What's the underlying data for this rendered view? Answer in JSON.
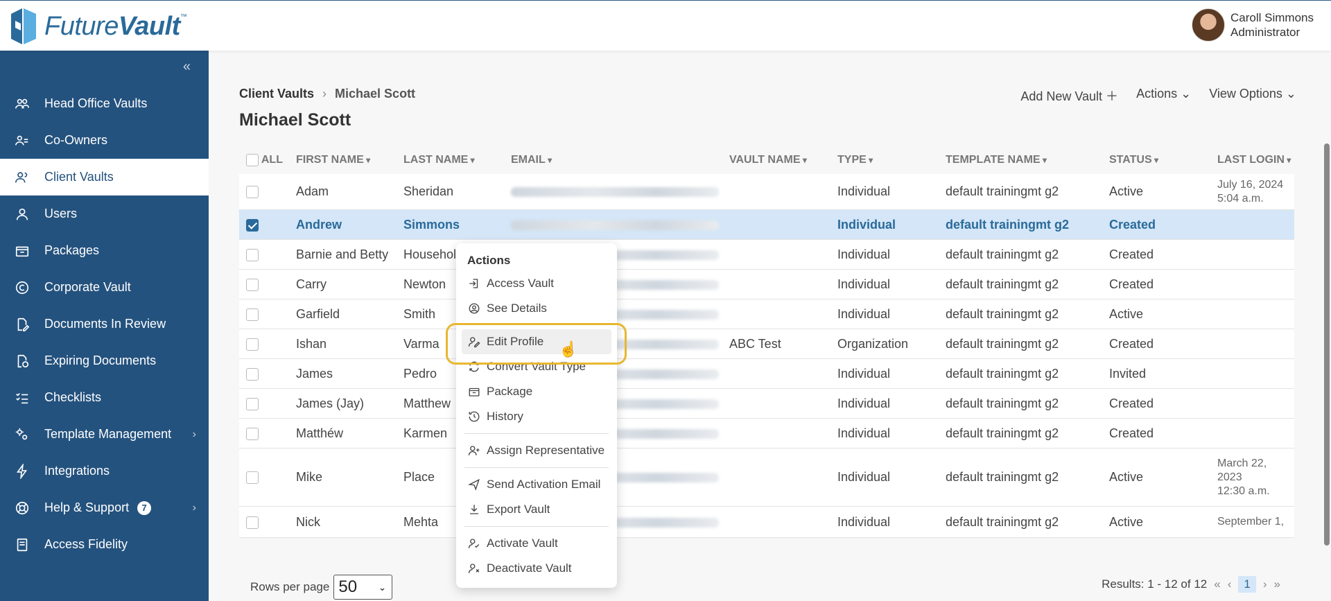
{
  "app": {
    "logo_prefix": "Future",
    "logo_bold": "Vault",
    "logo_tm": "™"
  },
  "user": {
    "name": "Caroll Simmons",
    "role": "Administrator"
  },
  "sidebar": {
    "collapse": "«",
    "items": [
      {
        "label": "Head Office Vaults",
        "icon": "users-group-icon"
      },
      {
        "label": "Co-Owners",
        "icon": "co-owners-icon"
      },
      {
        "label": "Client Vaults",
        "icon": "client-icon",
        "active": true
      },
      {
        "label": "Users",
        "icon": "user-icon"
      },
      {
        "label": "Packages",
        "icon": "package-icon"
      },
      {
        "label": "Corporate Vault",
        "icon": "copyright-icon"
      },
      {
        "label": "Documents In Review",
        "icon": "document-edit-icon"
      },
      {
        "label": "Expiring Documents",
        "icon": "document-clock-icon"
      },
      {
        "label": "Checklists",
        "icon": "checklist-icon"
      },
      {
        "label": "Template Management",
        "icon": "template-gear-icon",
        "chevron": "›"
      },
      {
        "label": "Integrations",
        "icon": "bolt-icon"
      },
      {
        "label": "Help & Support",
        "icon": "lifebuoy-icon",
        "badge": "7",
        "chevron": "›"
      },
      {
        "label": "Access Fidelity",
        "icon": "book-icon"
      }
    ]
  },
  "breadcrumb": {
    "parent": "Client Vaults",
    "sep": "›",
    "current": "Michael Scott"
  },
  "page_title": "Michael Scott",
  "top_actions": {
    "add": "Add New Vault ＋",
    "actions": "Actions ⌄",
    "view": "View Options ⌄"
  },
  "table": {
    "headers": {
      "all": "ALL",
      "first": "FIRST NAME",
      "last": "LAST NAME",
      "email": "EMAIL",
      "vault": "VAULT NAME",
      "type": "TYPE",
      "template": "TEMPLATE NAME",
      "status": "STATUS",
      "login": "LAST LOGIN"
    },
    "rows": [
      {
        "first": "Adam",
        "last": "Sheridan",
        "vault": "",
        "type": "Individual",
        "template": "default trainingmt g2",
        "status": "Active",
        "login_date": "July 16, 2024",
        "login_time": "5:04 a.m."
      },
      {
        "first": "Andrew",
        "last": "Simmons",
        "vault": "",
        "type": "Individual",
        "template": "default trainingmt g2",
        "status": "Created",
        "login_date": "",
        "login_time": ""
      },
      {
        "first": "Barnie and Betty",
        "last": "Househol",
        "vault": "",
        "type": "Individual",
        "template": "default trainingmt g2",
        "status": "Created",
        "login_date": "",
        "login_time": ""
      },
      {
        "first": "Carry",
        "last": "Newton",
        "vault": "",
        "type": "Individual",
        "template": "default trainingmt g2",
        "status": "Created",
        "login_date": "",
        "login_time": ""
      },
      {
        "first": "Garfield",
        "last": "Smith",
        "vault": "",
        "type": "Individual",
        "template": "default trainingmt g2",
        "status": "Active",
        "login_date": "",
        "login_time": ""
      },
      {
        "first": "Ishan",
        "last": "Varma",
        "vault": "ABC Test",
        "type": "Organization",
        "template": "default trainingmt g2",
        "status": "Created",
        "login_date": "",
        "login_time": ""
      },
      {
        "first": "James",
        "last": "Pedro",
        "vault": "",
        "type": "Individual",
        "template": "default trainingmt g2",
        "status": "Invited",
        "login_date": "",
        "login_time": ""
      },
      {
        "first": "James (Jay)",
        "last": "Matthew",
        "vault": "",
        "type": "Individual",
        "template": "default trainingmt g2",
        "status": "Created",
        "login_date": "",
        "login_time": ""
      },
      {
        "first": "Matthéw",
        "last": "Karmen",
        "vault": "",
        "type": "Individual",
        "template": "default trainingmt g2",
        "status": "Created",
        "login_date": "",
        "login_time": ""
      },
      {
        "first": "Mike",
        "last": "Place",
        "vault": "",
        "type": "Individual",
        "template": "default trainingmt g2",
        "status": "Active",
        "login_date": "March 22, 2023",
        "login_time": "12:30 a.m."
      },
      {
        "first": "Nick",
        "last": "Mehta",
        "vault": "",
        "type": "Individual",
        "template": "default trainingmt g2",
        "status": "Active",
        "login_date": "September 1,",
        "login_time": ""
      }
    ]
  },
  "footer": {
    "rows_label": "Rows per page",
    "rows_value": "50",
    "results": "Results: 1 - 12 of 12",
    "first": "«",
    "prev": "‹",
    "page": "1",
    "next": "›",
    "last": "»"
  },
  "menu": {
    "title": "Actions",
    "items": [
      {
        "label": "Access Vault",
        "icon": "login-icon"
      },
      {
        "label": "See Details",
        "icon": "user-circle-icon"
      },
      {
        "label": "Edit Profile",
        "icon": "user-edit-icon",
        "hover": true
      },
      {
        "label": "Convert Vault Type",
        "icon": "convert-icon"
      },
      {
        "label": "Package",
        "icon": "package-icon"
      },
      {
        "label": "History",
        "icon": "history-icon"
      },
      {
        "label": "Assign Representative",
        "icon": "user-plus-icon"
      },
      {
        "label": "Send Activation Email",
        "icon": "send-icon"
      },
      {
        "label": "Export Vault",
        "icon": "download-icon"
      },
      {
        "label": "Activate Vault",
        "icon": "user-check-icon"
      },
      {
        "label": "Deactivate Vault",
        "icon": "user-x-icon"
      }
    ]
  }
}
